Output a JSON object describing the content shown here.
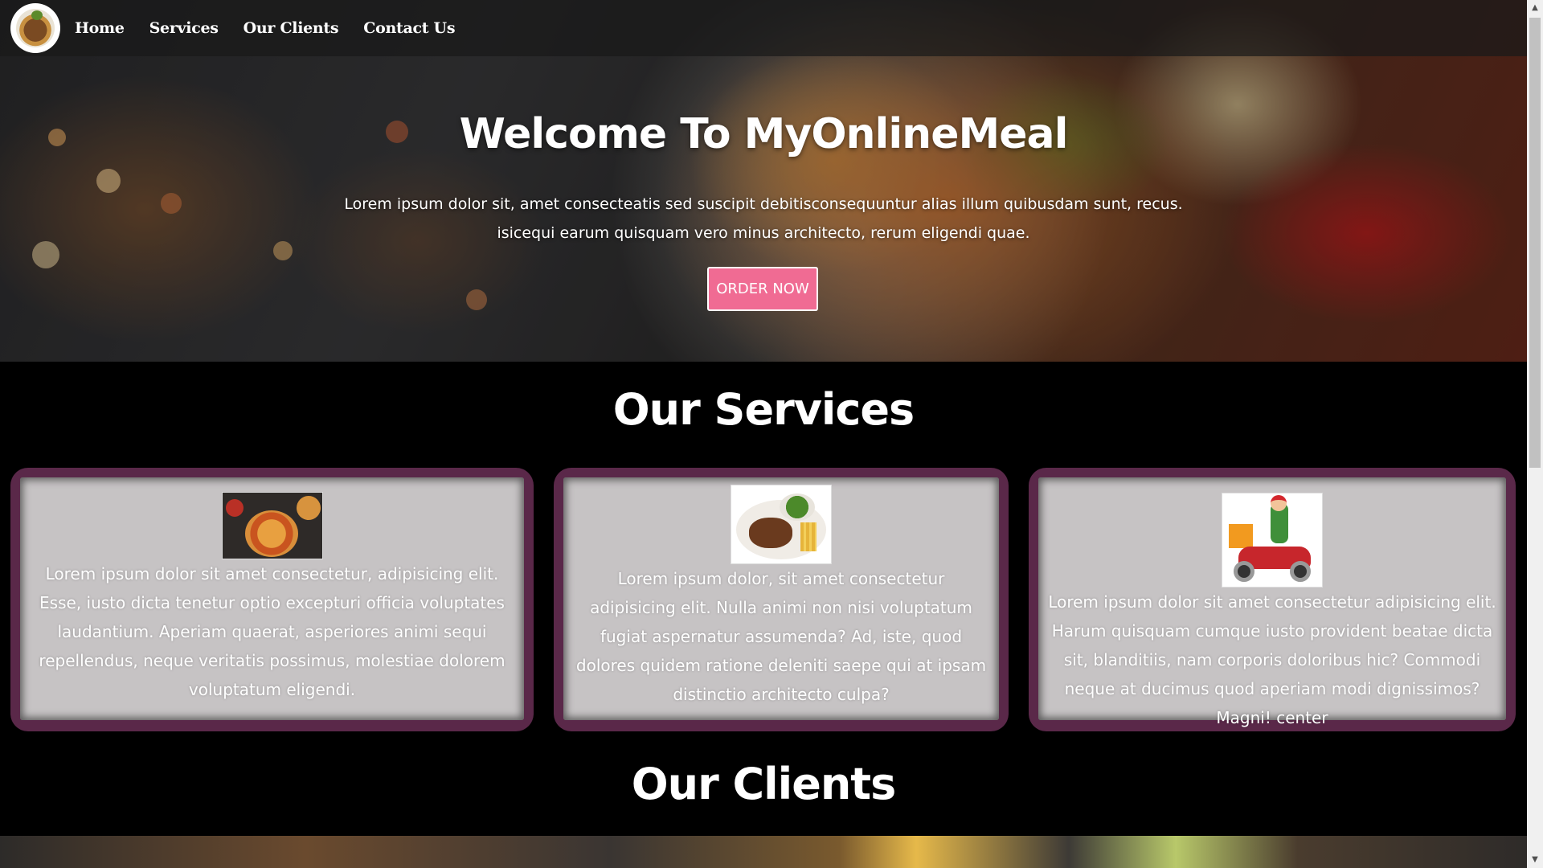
{
  "nav": {
    "items": [
      {
        "label": "Home"
      },
      {
        "label": "Services"
      },
      {
        "label": "Our Clients"
      },
      {
        "label": "Contact Us"
      }
    ]
  },
  "hero": {
    "title": "Welcome To MyOnlineMeal",
    "text": "Lorem ipsum dolor sit, amet consecteatis sed suscipit debitisconsequuntur alias illum quibusdam sunt, recus. isicequi earum quisquam vero minus architecto, rerum eligendi quae.",
    "button_label": "ORDER NOW",
    "button_color": "#f06b93"
  },
  "services": {
    "title": "Our Services",
    "cards": [
      {
        "image": "pizza-image",
        "text": "Lorem ipsum dolor sit amet consectetur, adipisicing elit. Esse, iusto dicta tenetur optio excepturi officia voluptates laudantium. Aperiam quaerat, asperiores animi sequi repellendus, neque veritatis possimus, molestiae dolorem voluptatum eligendi."
      },
      {
        "image": "steak-plate-image",
        "text": "Lorem ipsum dolor, sit amet consectetur adipisicing elit. Nulla animi non nisi voluptatum fugiat aspernatur assumenda? Ad, iste, quod dolores quidem ratione deleniti saepe qui at ipsam distinctio architecto culpa?"
      },
      {
        "image": "delivery-scooter-image",
        "text": "Lorem ipsum dolor sit amet consectetur adipisicing elit. Harum quisquam cumque iusto provident beatae dicta sit, blanditiis, nam corporis doloribus hic? Commodi neque at ducimus quod aperiam modi dignissimos? Magni! center"
      }
    ],
    "card_border_color": "#5a2849",
    "card_bg_color": "#c6c3c4"
  },
  "clients": {
    "title": "Our Clients"
  }
}
